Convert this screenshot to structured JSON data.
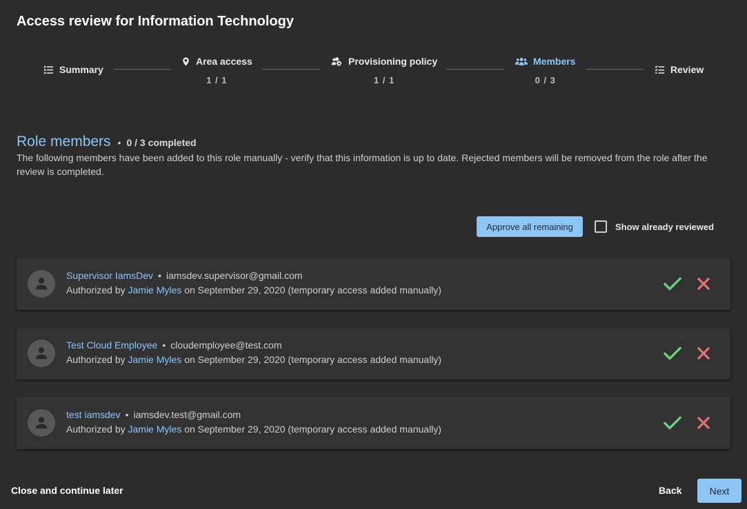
{
  "dialog": {
    "title": "Access review for Information Technology"
  },
  "stepper": {
    "steps": [
      {
        "label": "Summary",
        "count": "",
        "icon": "list-icon",
        "active": false
      },
      {
        "label": "Area access",
        "count": "1 / 1",
        "icon": "location-pin-icon",
        "active": false
      },
      {
        "label": "Provisioning policy",
        "count": "1 / 1",
        "icon": "users-cog-icon",
        "active": false
      },
      {
        "label": "Members",
        "count": "0 / 3",
        "icon": "users-icon",
        "active": true
      },
      {
        "label": "Review",
        "count": "",
        "icon": "checklist-icon",
        "active": false
      }
    ]
  },
  "section": {
    "title": "Role members",
    "status": "0 / 3 completed",
    "description": "The following members have been added to this role manually - verify that this information is up to date. Rejected members will be removed from the role after the review is completed."
  },
  "toolbar": {
    "approve_all_label": "Approve all remaining",
    "show_reviewed_label": "Show already reviewed",
    "show_reviewed_checked": false
  },
  "members": [
    {
      "name": "Supervisor IamsDev",
      "email": "iamsdev.supervisor@gmail.com",
      "authorized_prefix": "Authorized by",
      "authorized_by": "Jamie Myles",
      "authorized_suffix": "on September 29, 2020 (temporary access added manually)"
    },
    {
      "name": "Test Cloud Employee",
      "email": "cloudemployee@test.com",
      "authorized_prefix": "Authorized by",
      "authorized_by": "Jamie Myles",
      "authorized_suffix": "on September 29, 2020 (temporary access added manually)"
    },
    {
      "name": "test iamsdev",
      "email": "iamsdev.test@gmail.com",
      "authorized_prefix": "Authorized by",
      "authorized_by": "Jamie Myles",
      "authorized_suffix": "on September 29, 2020 (temporary access added manually)"
    }
  ],
  "footer": {
    "close_later_label": "Close and continue later",
    "back_label": "Back",
    "next_label": "Next"
  },
  "colors": {
    "background": "#2c2c2c",
    "card": "#323232",
    "accent": "#8ec5f7",
    "approve": "#6fcf7a",
    "reject": "#e57373"
  }
}
